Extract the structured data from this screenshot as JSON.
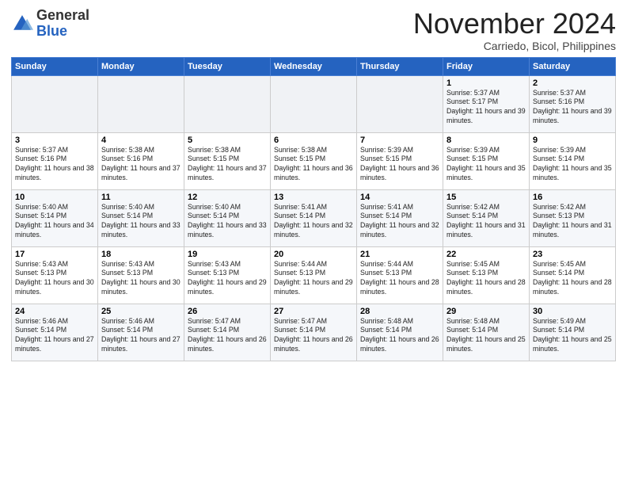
{
  "logo": {
    "general": "General",
    "blue": "Blue"
  },
  "title": "November 2024",
  "location": "Carriedo, Bicol, Philippines",
  "weekdays": [
    "Sunday",
    "Monday",
    "Tuesday",
    "Wednesday",
    "Thursday",
    "Friday",
    "Saturday"
  ],
  "weeks": [
    [
      {
        "day": "",
        "info": ""
      },
      {
        "day": "",
        "info": ""
      },
      {
        "day": "",
        "info": ""
      },
      {
        "day": "",
        "info": ""
      },
      {
        "day": "",
        "info": ""
      },
      {
        "day": "1",
        "info": "Sunrise: 5:37 AM\nSunset: 5:17 PM\nDaylight: 11 hours and 39 minutes."
      },
      {
        "day": "2",
        "info": "Sunrise: 5:37 AM\nSunset: 5:16 PM\nDaylight: 11 hours and 39 minutes."
      }
    ],
    [
      {
        "day": "3",
        "info": "Sunrise: 5:37 AM\nSunset: 5:16 PM\nDaylight: 11 hours and 38 minutes."
      },
      {
        "day": "4",
        "info": "Sunrise: 5:38 AM\nSunset: 5:16 PM\nDaylight: 11 hours and 37 minutes."
      },
      {
        "day": "5",
        "info": "Sunrise: 5:38 AM\nSunset: 5:15 PM\nDaylight: 11 hours and 37 minutes."
      },
      {
        "day": "6",
        "info": "Sunrise: 5:38 AM\nSunset: 5:15 PM\nDaylight: 11 hours and 36 minutes."
      },
      {
        "day": "7",
        "info": "Sunrise: 5:39 AM\nSunset: 5:15 PM\nDaylight: 11 hours and 36 minutes."
      },
      {
        "day": "8",
        "info": "Sunrise: 5:39 AM\nSunset: 5:15 PM\nDaylight: 11 hours and 35 minutes."
      },
      {
        "day": "9",
        "info": "Sunrise: 5:39 AM\nSunset: 5:14 PM\nDaylight: 11 hours and 35 minutes."
      }
    ],
    [
      {
        "day": "10",
        "info": "Sunrise: 5:40 AM\nSunset: 5:14 PM\nDaylight: 11 hours and 34 minutes."
      },
      {
        "day": "11",
        "info": "Sunrise: 5:40 AM\nSunset: 5:14 PM\nDaylight: 11 hours and 33 minutes."
      },
      {
        "day": "12",
        "info": "Sunrise: 5:40 AM\nSunset: 5:14 PM\nDaylight: 11 hours and 33 minutes."
      },
      {
        "day": "13",
        "info": "Sunrise: 5:41 AM\nSunset: 5:14 PM\nDaylight: 11 hours and 32 minutes."
      },
      {
        "day": "14",
        "info": "Sunrise: 5:41 AM\nSunset: 5:14 PM\nDaylight: 11 hours and 32 minutes."
      },
      {
        "day": "15",
        "info": "Sunrise: 5:42 AM\nSunset: 5:14 PM\nDaylight: 11 hours and 31 minutes."
      },
      {
        "day": "16",
        "info": "Sunrise: 5:42 AM\nSunset: 5:13 PM\nDaylight: 11 hours and 31 minutes."
      }
    ],
    [
      {
        "day": "17",
        "info": "Sunrise: 5:43 AM\nSunset: 5:13 PM\nDaylight: 11 hours and 30 minutes."
      },
      {
        "day": "18",
        "info": "Sunrise: 5:43 AM\nSunset: 5:13 PM\nDaylight: 11 hours and 30 minutes."
      },
      {
        "day": "19",
        "info": "Sunrise: 5:43 AM\nSunset: 5:13 PM\nDaylight: 11 hours and 29 minutes."
      },
      {
        "day": "20",
        "info": "Sunrise: 5:44 AM\nSunset: 5:13 PM\nDaylight: 11 hours and 29 minutes."
      },
      {
        "day": "21",
        "info": "Sunrise: 5:44 AM\nSunset: 5:13 PM\nDaylight: 11 hours and 28 minutes."
      },
      {
        "day": "22",
        "info": "Sunrise: 5:45 AM\nSunset: 5:13 PM\nDaylight: 11 hours and 28 minutes."
      },
      {
        "day": "23",
        "info": "Sunrise: 5:45 AM\nSunset: 5:14 PM\nDaylight: 11 hours and 28 minutes."
      }
    ],
    [
      {
        "day": "24",
        "info": "Sunrise: 5:46 AM\nSunset: 5:14 PM\nDaylight: 11 hours and 27 minutes."
      },
      {
        "day": "25",
        "info": "Sunrise: 5:46 AM\nSunset: 5:14 PM\nDaylight: 11 hours and 27 minutes."
      },
      {
        "day": "26",
        "info": "Sunrise: 5:47 AM\nSunset: 5:14 PM\nDaylight: 11 hours and 26 minutes."
      },
      {
        "day": "27",
        "info": "Sunrise: 5:47 AM\nSunset: 5:14 PM\nDaylight: 11 hours and 26 minutes."
      },
      {
        "day": "28",
        "info": "Sunrise: 5:48 AM\nSunset: 5:14 PM\nDaylight: 11 hours and 26 minutes."
      },
      {
        "day": "29",
        "info": "Sunrise: 5:48 AM\nSunset: 5:14 PM\nDaylight: 11 hours and 25 minutes."
      },
      {
        "day": "30",
        "info": "Sunrise: 5:49 AM\nSunset: 5:14 PM\nDaylight: 11 hours and 25 minutes."
      }
    ]
  ]
}
